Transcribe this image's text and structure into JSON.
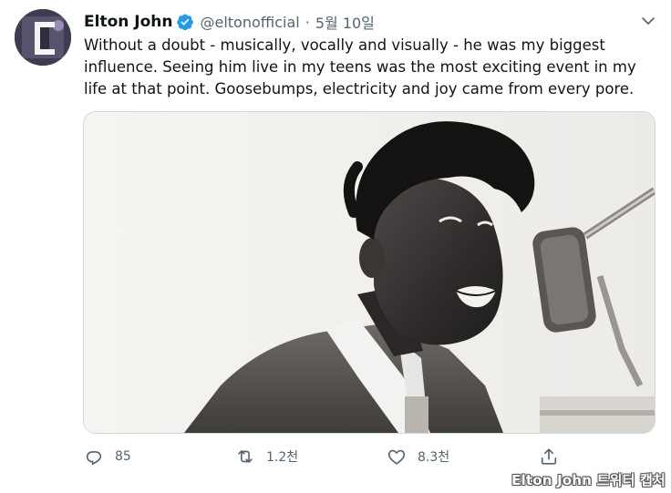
{
  "tweet": {
    "author_name": "Elton John",
    "handle": "@eltonofficial",
    "separator": "·",
    "date": "5월 10일",
    "text": "Without a doubt - musically, vocally and visually - he was my biggest influence. Seeing him live in my teens was the most exciting event in my life at that point. Goosebumps, electricity and joy came from every pore.",
    "verified": true
  },
  "actions": {
    "reply_count": "85",
    "retweet_count": "1.2천",
    "like_count": "8.3천"
  },
  "icons": {
    "verified": "verified-badge-icon",
    "more": "chevron-down-icon",
    "reply": "reply-icon",
    "retweet": "retweet-icon",
    "like": "heart-icon",
    "share": "share-icon"
  },
  "colors": {
    "verified_blue": "#1d9bf0",
    "text_primary": "#0f1419",
    "text_secondary": "#536471",
    "border": "#cfd9de"
  },
  "caption": "Elton John 트위터 캡처"
}
